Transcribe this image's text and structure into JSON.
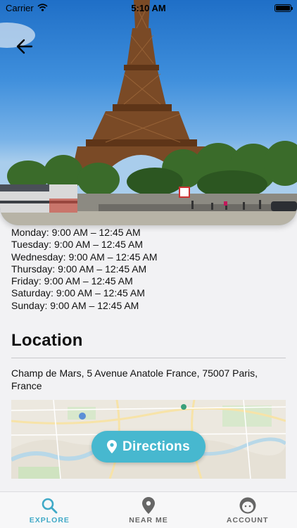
{
  "status_bar": {
    "carrier": "Carrier",
    "time": "5:10 AM"
  },
  "opening_hours": [
    "Monday: 9:00 AM – 12:45 AM",
    "Tuesday: 9:00 AM – 12:45 AM",
    "Wednesday: 9:00 AM – 12:45 AM",
    "Thursday: 9:00 AM – 12:45 AM",
    "Friday: 9:00 AM – 12:45 AM",
    "Saturday: 9:00 AM – 12:45 AM",
    "Sunday: 9:00 AM – 12:45 AM"
  ],
  "location": {
    "title": "Location",
    "address": "Champ de Mars, 5 Avenue Anatole France, 75007 Paris, France",
    "directions_label": "Directions"
  },
  "tabs": [
    {
      "label": "EXPLORE",
      "icon": "search-icon",
      "active": true
    },
    {
      "label": "NEAR ME",
      "icon": "map-pin-icon",
      "active": false
    },
    {
      "label": "ACCOUNT",
      "icon": "user-face-icon",
      "active": false
    }
  ],
  "colors": {
    "accent": "#47b8cf",
    "active_tab": "#3fa9c7",
    "inactive_tab": "#666666"
  }
}
